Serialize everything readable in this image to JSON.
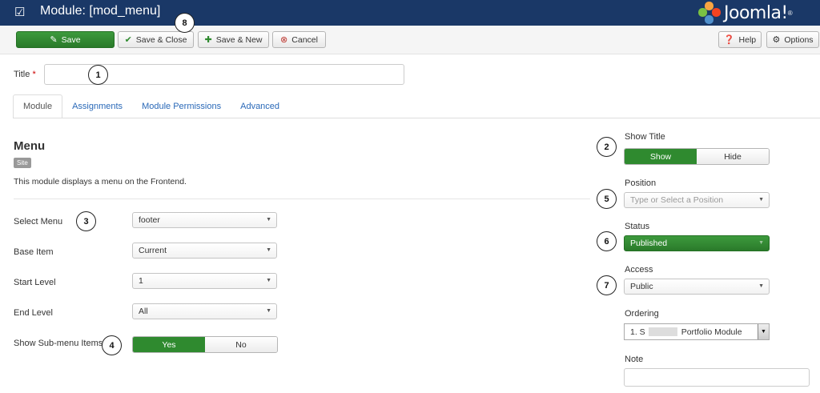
{
  "header": {
    "title": "Module: [mod_menu]",
    "logo_text": "Joomla!",
    "logo_mark": "®"
  },
  "toolbar": {
    "save": "Save",
    "save_close": "Save & Close",
    "save_new": "Save & New",
    "cancel": "Cancel",
    "help": "Help",
    "options": "Options"
  },
  "form": {
    "title_label": "Title",
    "required_mark": "*",
    "title_value": ""
  },
  "tabs": [
    "Module",
    "Assignments",
    "Module Permissions",
    "Advanced"
  ],
  "module": {
    "heading": "Menu",
    "badge": "Site",
    "description": "This module displays a menu on the Frontend."
  },
  "fields": {
    "select_menu": {
      "label": "Select Menu",
      "value": "footer"
    },
    "base_item": {
      "label": "Base Item",
      "value": "Current"
    },
    "start_level": {
      "label": "Start Level",
      "value": "1"
    },
    "end_level": {
      "label": "End Level",
      "value": "All"
    },
    "show_submenu": {
      "label": "Show Sub-menu Items",
      "yes": "Yes",
      "no": "No",
      "selected": "Yes"
    }
  },
  "sidebar": {
    "show_title": {
      "label": "Show Title",
      "show": "Show",
      "hide": "Hide",
      "selected": "Show"
    },
    "position": {
      "label": "Position",
      "placeholder": "Type or Select a Position"
    },
    "status": {
      "label": "Status",
      "value": "Published"
    },
    "access": {
      "label": "Access",
      "value": "Public"
    },
    "ordering": {
      "label": "Ordering",
      "prefix": "1. S",
      "value": "Portfolio Module"
    },
    "note": {
      "label": "Note",
      "value": ""
    }
  },
  "callouts": [
    "1",
    "2",
    "3",
    "4",
    "5",
    "6",
    "7",
    "8"
  ],
  "colors": {
    "header": "#1a3867",
    "accent_green": "#2f8a2f",
    "link": "#2a69b8",
    "required": "#cc0000"
  }
}
